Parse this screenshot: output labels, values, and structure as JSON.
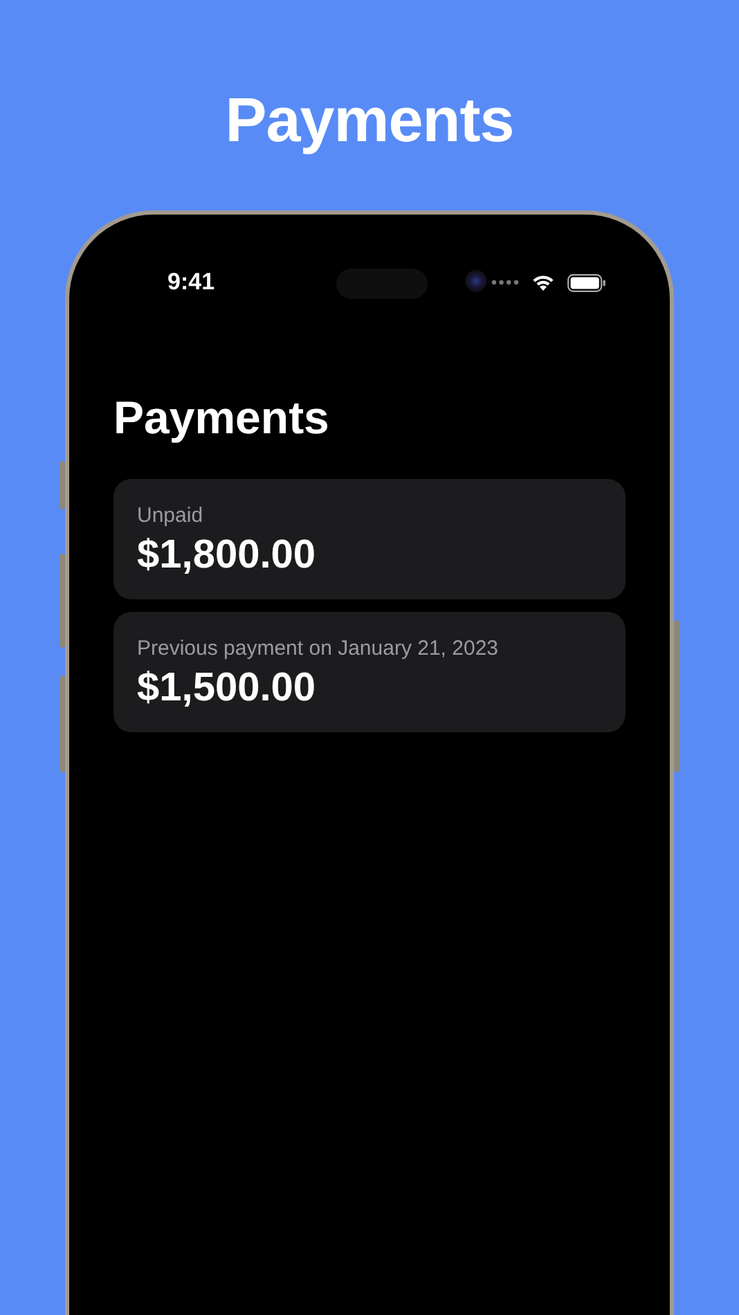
{
  "headline": "Payments",
  "status_bar": {
    "time": "9:41"
  },
  "screen_title": "Payments",
  "cards": [
    {
      "label": "Unpaid",
      "amount": "$1,800.00"
    },
    {
      "label": "Previous payment on January 21, 2023",
      "amount": "$1,500.00"
    }
  ]
}
